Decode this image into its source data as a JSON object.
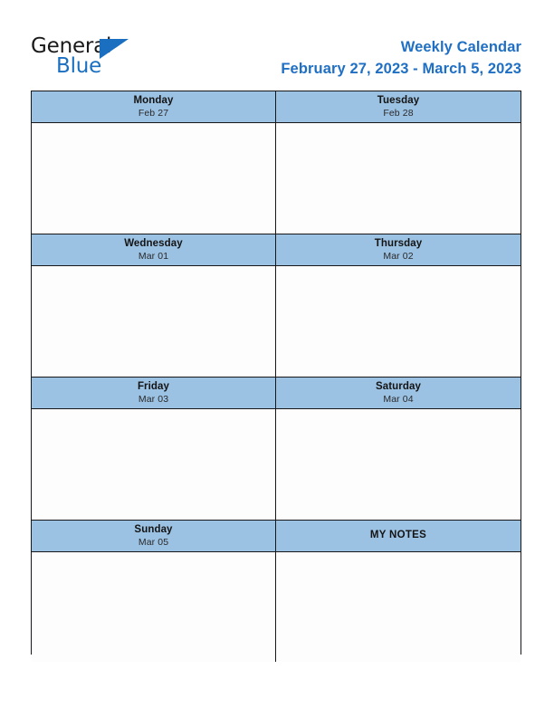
{
  "brand": {
    "name_part1": "General",
    "name_part2": "Blue",
    "triangle_icon": "triangle-icon",
    "accent_color": "#1a6fc0"
  },
  "header": {
    "title": "Weekly Calendar",
    "date_range": "February 27, 2023 - March 5, 2023",
    "title_color": "#1f6fc4"
  },
  "colors": {
    "header_fill": "#9bc1e3",
    "cell_fill": "#fdfdfd",
    "border": "#17171a"
  },
  "calendar": {
    "rows": [
      {
        "left": {
          "day": "Monday",
          "date": "Feb 27"
        },
        "right": {
          "day": "Tuesday",
          "date": "Feb 28"
        }
      },
      {
        "left": {
          "day": "Wednesday",
          "date": "Mar 01"
        },
        "right": {
          "day": "Thursday",
          "date": "Mar 02"
        }
      },
      {
        "left": {
          "day": "Friday",
          "date": "Mar 03"
        },
        "right": {
          "day": "Saturday",
          "date": "Mar 04"
        }
      },
      {
        "left": {
          "day": "Sunday",
          "date": "Mar 05"
        },
        "right": {
          "day": "MY NOTES",
          "date": ""
        }
      }
    ]
  }
}
